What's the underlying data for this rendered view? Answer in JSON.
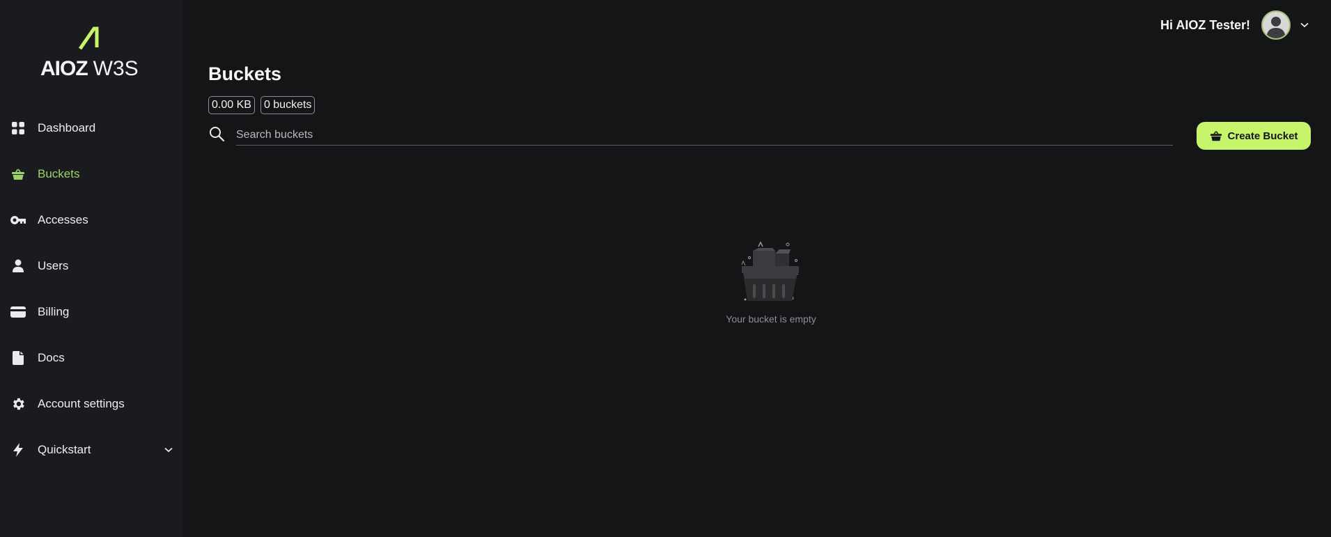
{
  "brand": {
    "bold": "AIOZ",
    "light": "W3S"
  },
  "sidebar": {
    "items": [
      {
        "label": "Dashboard",
        "icon": "dashboard-grid-icon",
        "active": false
      },
      {
        "label": "Buckets",
        "icon": "basket-icon",
        "active": true
      },
      {
        "label": "Accesses",
        "icon": "key-icon",
        "active": false
      },
      {
        "label": "Users",
        "icon": "user-icon",
        "active": false
      },
      {
        "label": "Billing",
        "icon": "credit-card-icon",
        "active": false
      },
      {
        "label": "Docs",
        "icon": "document-icon",
        "active": false
      },
      {
        "label": "Account settings",
        "icon": "gear-icon",
        "active": false
      },
      {
        "label": "Quickstart",
        "icon": "lightning-icon",
        "active": false,
        "expandable": true
      }
    ]
  },
  "header": {
    "greeting": "Hi AIOZ Tester!"
  },
  "main": {
    "title": "Buckets",
    "stats": {
      "size": "0.00 KB",
      "count": "0 buckets"
    },
    "search": {
      "placeholder": "Search buckets",
      "value": ""
    },
    "create_button": "Create Bucket",
    "empty_message": "Your bucket is empty"
  },
  "colors": {
    "accent": "#c6f46b",
    "active_nav": "#9bd36a",
    "background": "#141517",
    "sidebar": "#1a1b1e"
  }
}
